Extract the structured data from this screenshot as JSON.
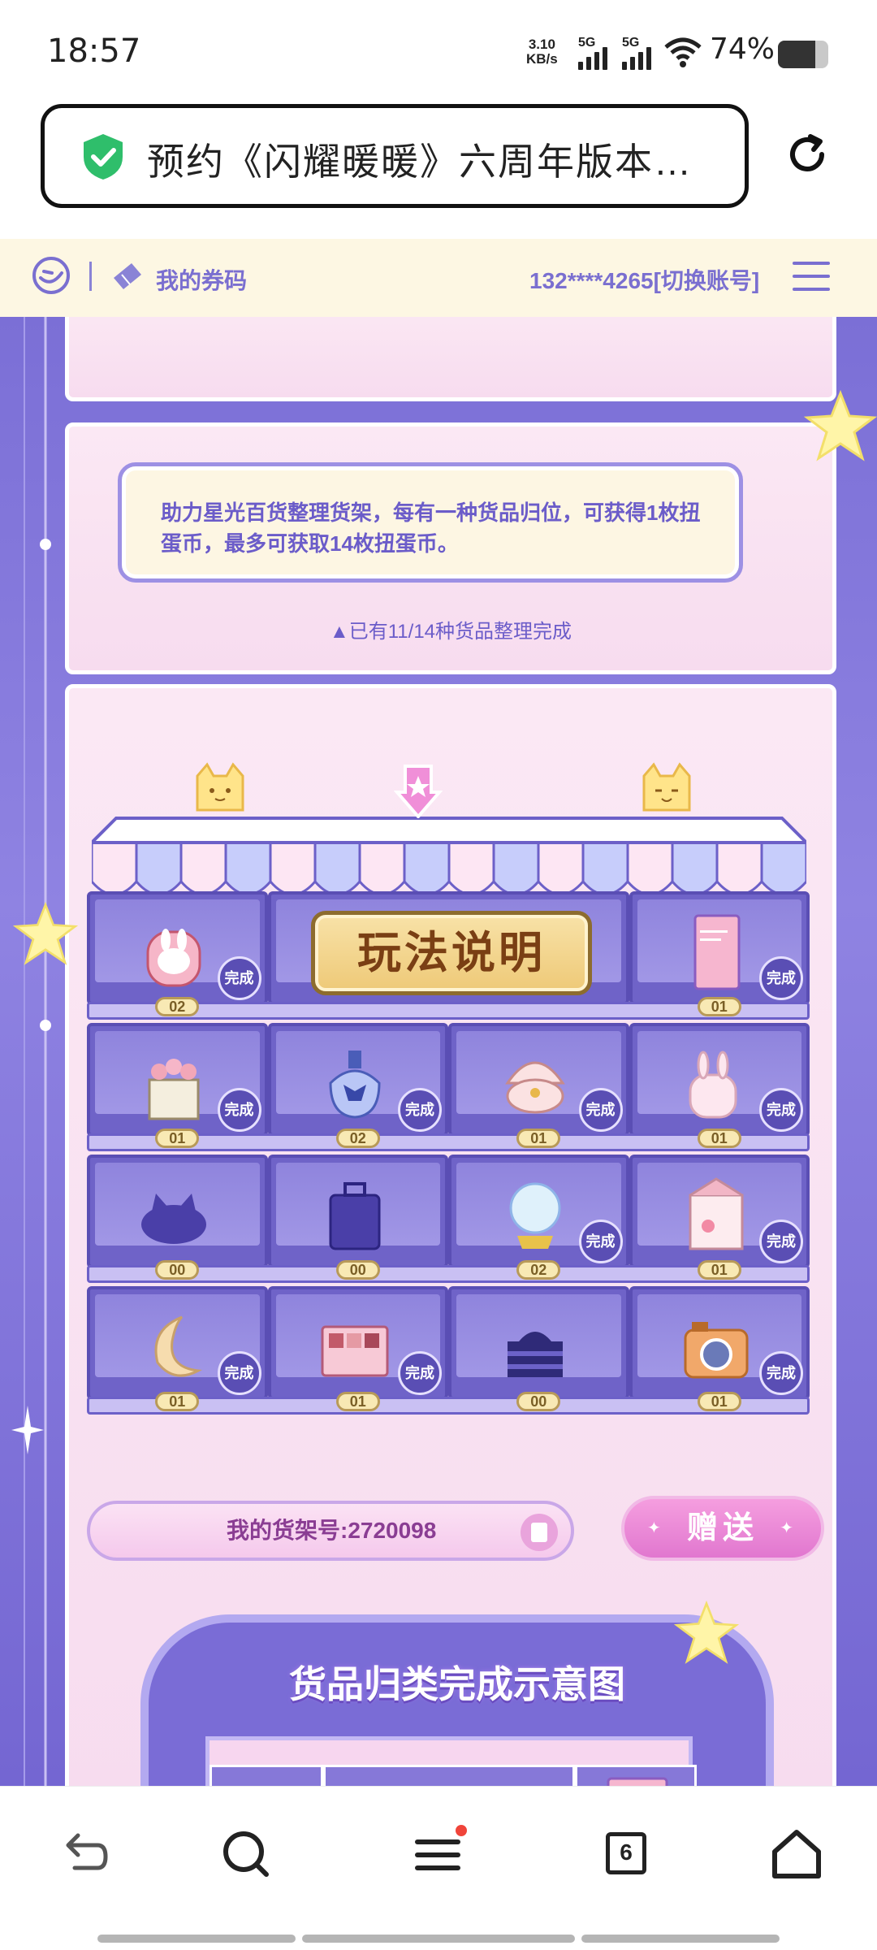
{
  "status": {
    "time": "18:57",
    "net_speed_top": "3.10",
    "net_speed_unit": "KB/s",
    "sim1": "5G",
    "sim2": "5G",
    "battery": "74%",
    "battery_level": 0.74
  },
  "browser": {
    "url_title": "预约《闪耀暖暖》六周年版本…",
    "tab_count": "6"
  },
  "header": {
    "my_codes": "我的券码",
    "account": "132****4265[切换账号]"
  },
  "info": {
    "notice": "助力星光百货整理货架，每有一种货品归位，可获得1枚扭蛋币，最多可获取14枚扭蛋币。",
    "progress": "已有11/14种货品整理完成"
  },
  "shelf": {
    "rules_label": "玩法说明",
    "done_label": "完成",
    "rows": [
      [
        {
          "name": "bunny-backpack",
          "count": "02",
          "done": true
        },
        {
          "name": "rules",
          "count": "",
          "done": false
        },
        {
          "name": "rules",
          "count": "",
          "done": false
        },
        {
          "name": "photo-album",
          "count": "01",
          "done": true
        }
      ],
      [
        {
          "name": "flower-basket",
          "count": "01",
          "done": true
        },
        {
          "name": "perfume-bottle",
          "count": "02",
          "done": true
        },
        {
          "name": "shell-ring-box",
          "count": "01",
          "done": true
        },
        {
          "name": "bunny-mug",
          "count": "01",
          "done": true
        }
      ],
      [
        {
          "name": "cat-beret",
          "count": "00",
          "done": false
        },
        {
          "name": "suitcase",
          "count": "00",
          "done": false
        },
        {
          "name": "crystal-ball",
          "count": "02",
          "done": true
        },
        {
          "name": "milk-carton",
          "count": "01",
          "done": true
        }
      ],
      [
        {
          "name": "moon-pillow",
          "count": "01",
          "done": true
        },
        {
          "name": "eyeshadow-palette",
          "count": "01",
          "done": true
        },
        {
          "name": "cake",
          "count": "00",
          "done": false
        },
        {
          "name": "camera",
          "count": "01",
          "done": true
        }
      ]
    ]
  },
  "footer": {
    "shelf_id": "我的货架号:2720098",
    "gift_label": "赠送",
    "diagram_title": "货品归类完成示意图"
  },
  "colors": {
    "accent": "#7b6fd6",
    "text_purple": "#6b5cc9",
    "pink": "#f59edf"
  }
}
